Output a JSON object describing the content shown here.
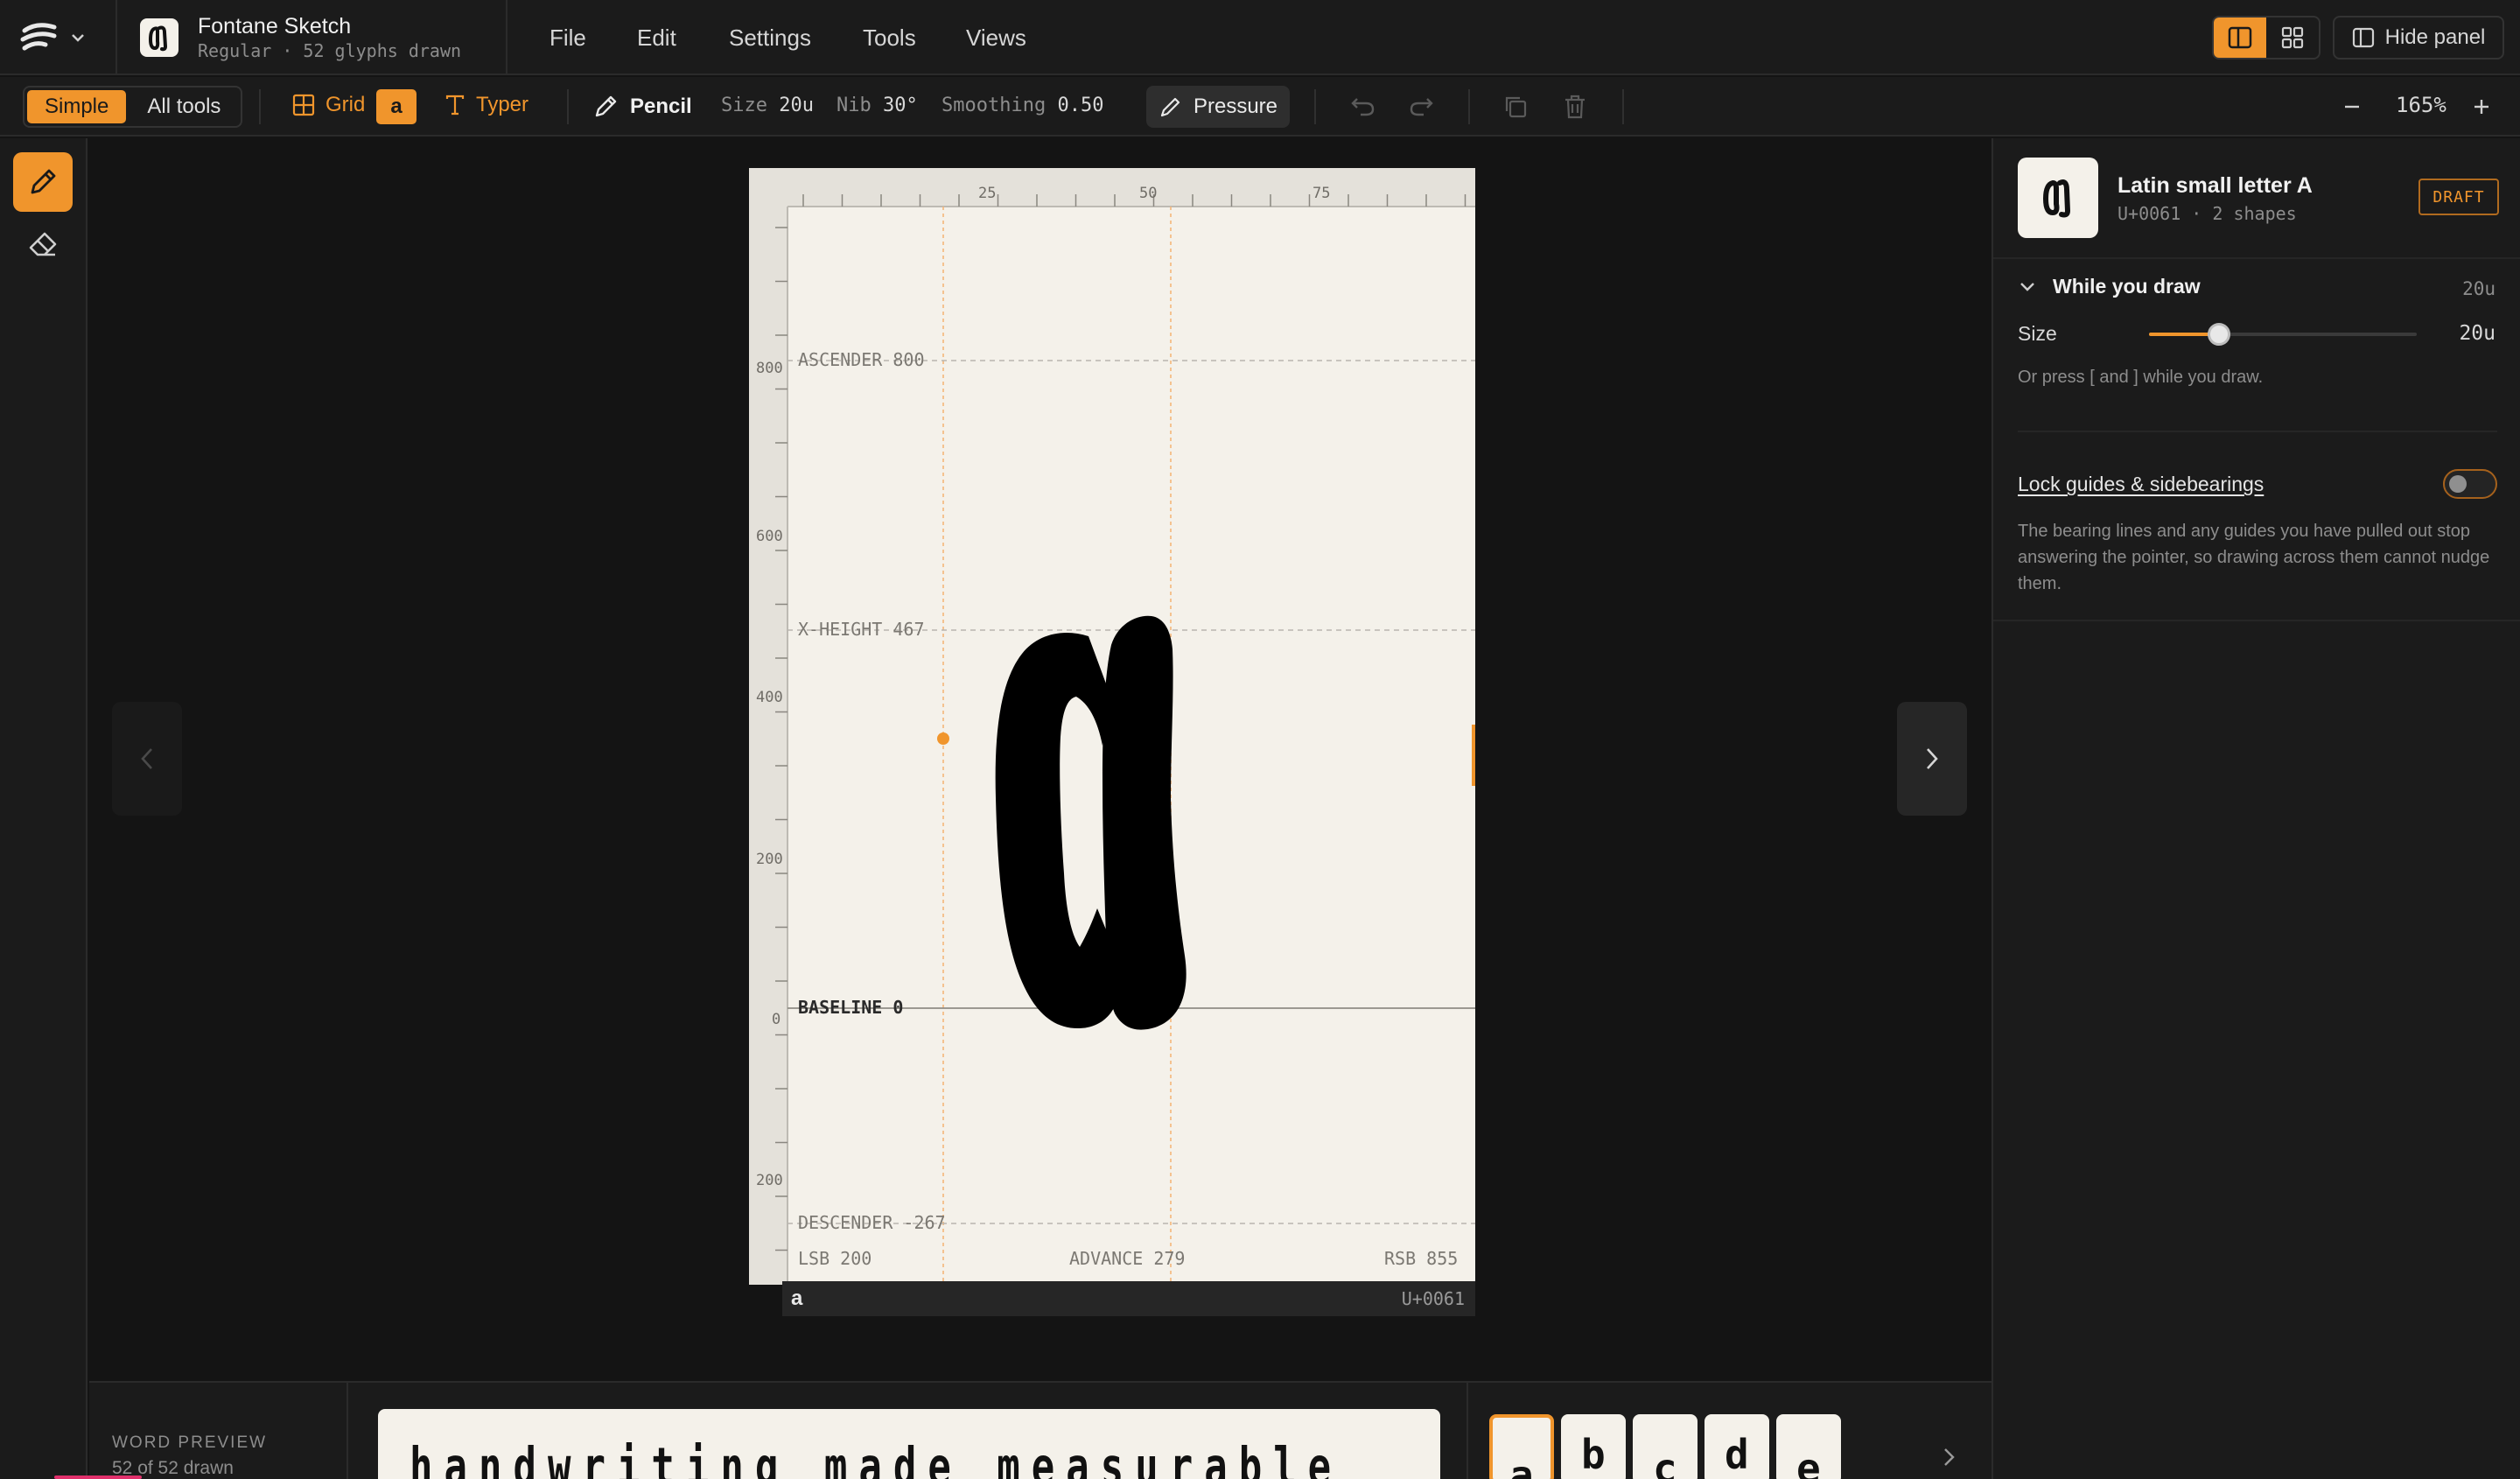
{
  "app": {
    "name": "Fontane Sketch",
    "subtitle": "Regular · 52 glyphs drawn"
  },
  "menu": [
    "File",
    "Edit",
    "Settings",
    "Tools",
    "Views"
  ],
  "header": {
    "hide_panel_label": "Hide panel"
  },
  "toolbar": {
    "mode_simple": "Simple",
    "mode_all_tools": "All tools",
    "grid_label": "Grid",
    "grid_glyph": "a",
    "typer_label": "Typer",
    "pencil_label": "Pencil",
    "size_label": "Size",
    "size_value": "20u",
    "nib_label": "Nib",
    "nib_value": "30°",
    "smoothing_label": "Smoothing",
    "smoothing_value": "0.50",
    "pressure_label": "Pressure",
    "zoom": "165%"
  },
  "ruler": {
    "top_ticks": [
      "25",
      "50",
      "75"
    ],
    "left_ticks": [
      "800",
      "600",
      "400",
      "200",
      "0",
      "200"
    ]
  },
  "guides": {
    "ascender": "ASCENDER 800",
    "x_height": "X-HEIGHT 467",
    "baseline": "BASELINE 0",
    "descender": "DESCENDER -267"
  },
  "metrics": {
    "lsb": "LSB 200",
    "advance": "ADVANCE 279",
    "rsb": "RSB 855"
  },
  "glyph_footer": {
    "char": "a",
    "unicode": "U+0061"
  },
  "panel": {
    "glyph_name": "Latin small letter A",
    "glyph_meta": "U+0061 · 2 shapes",
    "status": "DRAFT",
    "section_title": "While you draw",
    "section_value": "20u",
    "size_label": "Size",
    "size_value": "20u",
    "size_fraction": 0.26,
    "size_hint": "Or press [ and ] while you draw.",
    "lock_label": "Lock guides & sidebearings",
    "lock_on": false,
    "lock_desc": "The bearing lines and any guides you have pulled out stop answering the pointer, so drawing across them cannot nudge them."
  },
  "bottom": {
    "word_preview_label": "WORD PREVIEW",
    "drawn_count": "52 of 52 drawn",
    "preview_text": "handwriting made measurable",
    "tiles": [
      "a",
      "b",
      "c",
      "d",
      "e"
    ]
  },
  "colors": {
    "accent": "#f0952c",
    "paper": "#f4f1ea",
    "background": "#141414",
    "panel": "#1b1b1b"
  }
}
